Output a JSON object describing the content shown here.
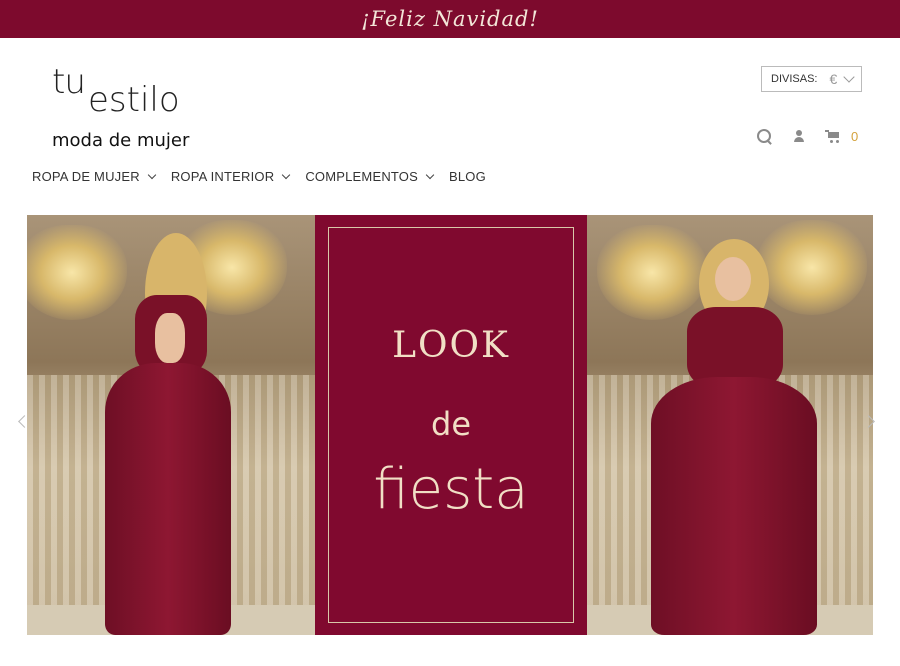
{
  "announcement": {
    "text": "¡Feliz Navidad!"
  },
  "logo": {
    "part1": "tu",
    "part2": "estilo",
    "tagline": "moda de mujer"
  },
  "currency": {
    "label": "DIVISAS:",
    "value": "€"
  },
  "header_icons": {
    "search": "search-icon",
    "account": "user-icon",
    "cart": "cart-icon",
    "cart_count": "0"
  },
  "nav": {
    "items": [
      {
        "label": "ROPA DE MUJER",
        "has_dropdown": true
      },
      {
        "label": "ROPA INTERIOR",
        "has_dropdown": true
      },
      {
        "label": "COMPLEMENTOS",
        "has_dropdown": true
      },
      {
        "label": "BLOG",
        "has_dropdown": false
      }
    ]
  },
  "banner": {
    "line1": "LOOK",
    "line2": "de",
    "line3": "fiesta"
  },
  "colors": {
    "brand": "#7d0a2d",
    "accent_gold": "#d4a23c",
    "banner_text": "#f1dfc5"
  }
}
